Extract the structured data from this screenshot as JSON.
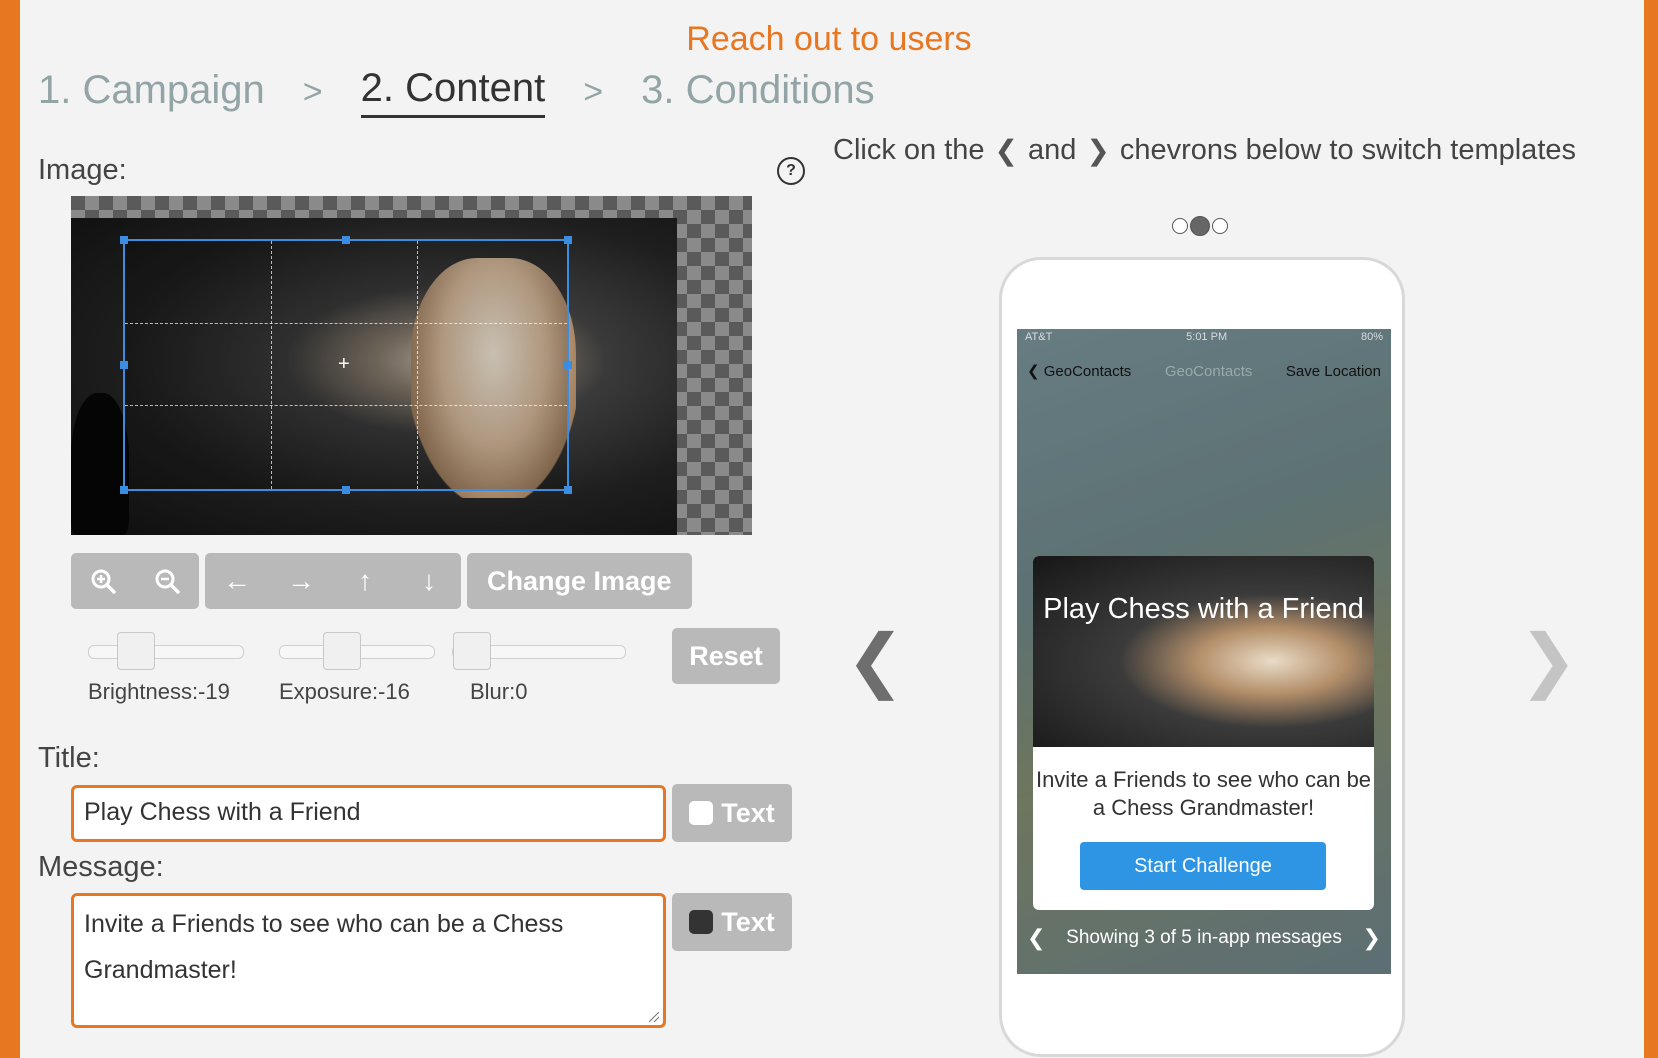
{
  "header": {
    "title": "Reach out to users"
  },
  "steps": [
    {
      "label": "1. Campaign",
      "active": false
    },
    {
      "label": "2. Content",
      "active": true
    },
    {
      "label": "3. Conditions",
      "active": false
    }
  ],
  "step_separator": ">",
  "editor": {
    "image_label": "Image:",
    "help_icon": "?",
    "toolbar": {
      "zoom_in_icon": "zoom-in-icon",
      "zoom_out_icon": "zoom-out-icon",
      "arrow_left_icon": "arrow-left-icon",
      "arrow_right_icon": "arrow-right-icon",
      "arrow_up_icon": "arrow-up-icon",
      "arrow_down_icon": "arrow-down-icon",
      "change_image_label": "Change Image"
    },
    "adjustments": {
      "brightness_label": "Brightness:-19",
      "exposure_label": "Exposure:-16",
      "blur_label": "Blur:0",
      "reset_label": "Reset"
    },
    "title_label": "Title:",
    "title_value": "Play Chess with a Friend",
    "title_text_toggle": "Text",
    "title_swatch_color": "#ffffff",
    "message_label": "Message:",
    "message_value": "Invite a Friends to see who can be a Chess Grandmaster!",
    "message_text_toggle": "Text",
    "message_swatch_color": "#333333"
  },
  "preview": {
    "hint_prefix": "Click on the",
    "hint_and": "and",
    "hint_suffix": "chevrons below to switch templates",
    "template_dots": {
      "count": 3,
      "active_index": 1
    },
    "phone": {
      "status_left": "AT&T",
      "status_time": "5:01 PM",
      "status_battery": "80%",
      "nav_back": "GeoContacts",
      "nav_title": "GeoContacts",
      "nav_right": "Save Location",
      "message_title": "Play Chess with a Friend",
      "message_body": "Invite a Friends to see who can be a Chess Grandmaster!",
      "cta_label": "Start Challenge",
      "pager_text": "Showing 3 of 5 in-app messages"
    }
  },
  "colors": {
    "accent": "#e87722",
    "button_gray": "#b9b9b9",
    "cta_blue": "#2d95e3",
    "crop_blue": "#3a8de0"
  }
}
